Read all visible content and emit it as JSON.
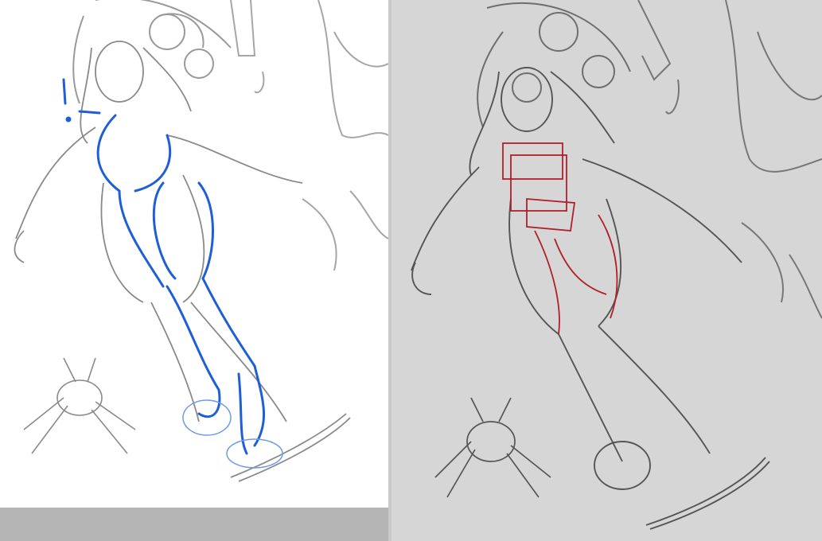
{
  "canvas": {
    "left_title": "",
    "right_title": ""
  },
  "colors": {
    "left_bg": "#ffffff",
    "right_bg": "#d6d6d6",
    "strip": "#b5b5b5",
    "pencil": "#8a8a8a",
    "pencil_dark": "#555555",
    "blue_gesture": "#1f5fd6",
    "red_construction": "#b0202a"
  },
  "panels": {
    "left": {
      "description_icon": "sketch-with-blue-gesture-icon"
    },
    "right": {
      "description_icon": "sketch-with-red-construction-icon"
    }
  }
}
